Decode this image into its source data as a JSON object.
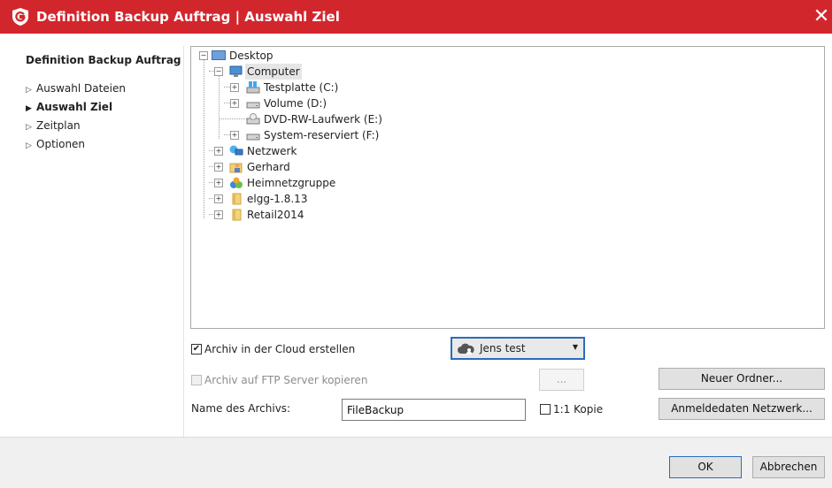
{
  "window": {
    "title": "Definition Backup Auftrag | Auswahl Ziel",
    "close_glyph": "✕",
    "logo_icon": "gdata-shield-icon",
    "accent_color": "#d2262d"
  },
  "sidebar": {
    "title": "Definition Backup Auftrag",
    "items": [
      {
        "label": "Auswahl Dateien",
        "active": false
      },
      {
        "label": "Auswahl Ziel",
        "active": true
      },
      {
        "label": "Zeitplan",
        "active": false
      },
      {
        "label": "Optionen",
        "active": false
      }
    ]
  },
  "tree": {
    "nodes": [
      {
        "label": "Desktop",
        "icon": "desktop-icon",
        "expander": "−"
      },
      {
        "label": "Computer",
        "icon": "computer-icon",
        "expander": "−"
      },
      {
        "label": "Testplatte (C:)",
        "icon": "system-drive-icon",
        "expander": "+"
      },
      {
        "label": "Volume (D:)",
        "icon": "drive-icon",
        "expander": "+"
      },
      {
        "label": "DVD-RW-Laufwerk (E:)",
        "icon": "dvd-drive-icon",
        "expander": ""
      },
      {
        "label": "System-reserviert (F:)",
        "icon": "drive-icon",
        "expander": "+"
      },
      {
        "label": "Netzwerk",
        "icon": "network-icon",
        "expander": "+"
      },
      {
        "label": "Gerhard",
        "icon": "user-folder-icon",
        "expander": "+"
      },
      {
        "label": "Heimnetzgruppe",
        "icon": "homegroup-icon",
        "expander": "+"
      },
      {
        "label": "elgg-1.8.13",
        "icon": "folder-icon",
        "expander": "+"
      },
      {
        "label": "Retail2014",
        "icon": "folder-icon",
        "expander": "+"
      }
    ]
  },
  "options": {
    "cloud_archive": {
      "label": "Archiv in der Cloud erstellen",
      "checked": true,
      "check_glyph": "✔"
    },
    "cloud_account": {
      "value": "Jens test",
      "icon": "cloud-user-icon",
      "caret": "▼"
    },
    "ftp_archive": {
      "label": "Archiv auf FTP Server kopieren",
      "checked": false,
      "enabled": false
    },
    "ftp_browse_label": "...",
    "archive_name": {
      "label": "Name des Archivs:",
      "value": "FileBackup"
    },
    "copy_1to1": {
      "label": "1:1 Kopie",
      "checked": false
    },
    "new_folder_label": "Neuer Ordner...",
    "network_credentials_label": "Anmeldedaten Netzwerk..."
  },
  "footer": {
    "ok_label": "OK",
    "cancel_label": "Abbrechen"
  }
}
